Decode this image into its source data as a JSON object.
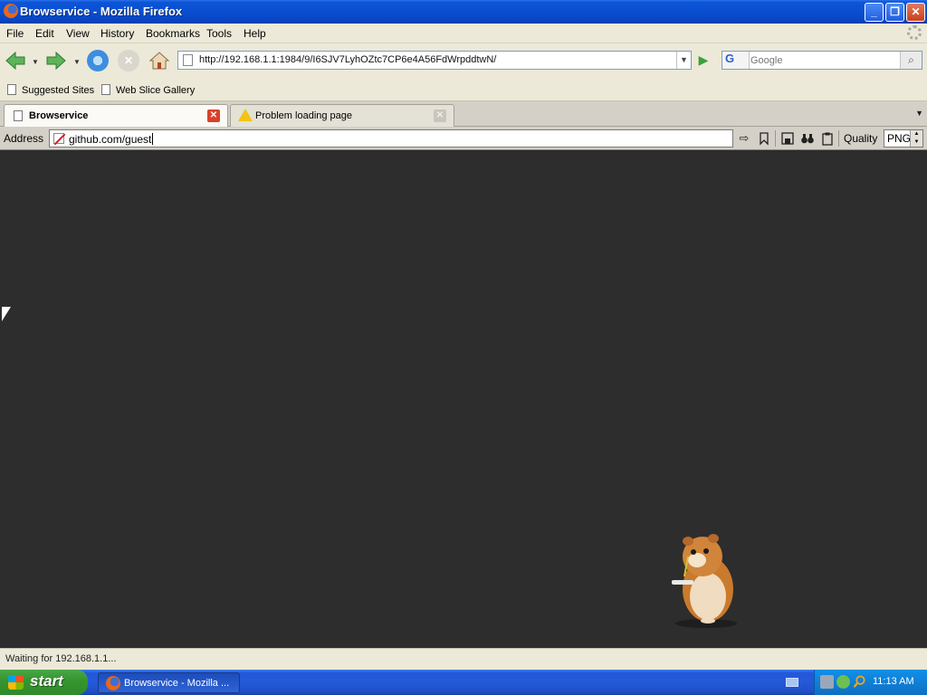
{
  "window": {
    "title": "Browservice - Mozilla Firefox",
    "controls": {
      "minimize": "_",
      "restore": "❐",
      "close": "✕"
    }
  },
  "menu": [
    "File",
    "Edit",
    "View",
    "History",
    "Bookmarks",
    "Tools",
    "Help"
  ],
  "navbar": {
    "url": "http://192.168.1.1:1984/9/I6SJV7LyhOZtc7CP6e4A56FdWrpddtwN/",
    "search_engine": "G",
    "search_placeholder": "Google"
  },
  "bookmarks": [
    "Suggested Sites",
    "Web Slice Gallery"
  ],
  "tabs": [
    {
      "label": "Browservice",
      "active": true
    },
    {
      "label": "Problem loading page",
      "active": false
    }
  ],
  "browservice": {
    "address_label": "Address",
    "address_value": "github.com/guest",
    "quality_label": "Quality",
    "quality_value": "PNG"
  },
  "status": {
    "text": "Waiting for 192.168.1.1..."
  },
  "taskbar": {
    "start_label": "start",
    "task_label": "Browservice - Mozilla ...",
    "clock": "11:13 AM"
  }
}
